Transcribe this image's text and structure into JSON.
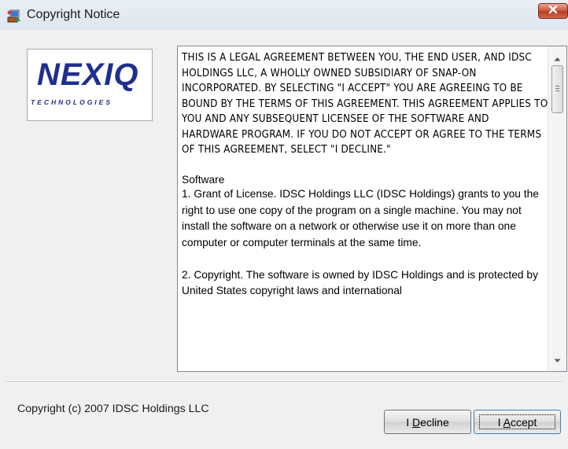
{
  "window": {
    "title": "Copyright Notice",
    "icon": "app-icon",
    "close_icon": "close-icon"
  },
  "logo": {
    "wordmark": "NEXIQ",
    "tagline": "TECHNOLOGIES"
  },
  "license": {
    "legal_paragraph": "THIS IS A LEGAL AGREEMENT BETWEEN YOU, THE END USER, AND IDSC HOLDINGS LLC, A WHOLLY OWNED SUBSIDIARY OF SNAP-ON INCORPORATED.  BY SELECTING \"I ACCEPT\" YOU ARE AGREEING TO BE BOUND BY THE TERMS OF THIS AGREEMENT.  THIS AGREEMENT APPLIES TO YOU AND ANY SUBSEQUENT LICENSEE OF THE SOFTWARE AND HARDWARE PROGRAM. IF YOU DO NOT ACCEPT OR AGREE TO THE TERMS OF THIS AGREEMENT, SELECT \"I DECLINE.\"",
    "section_heading": "Software",
    "grant_paragraph": "1. Grant of License. IDSC Holdings LLC (IDSC Holdings) grants to you the right to use one copy of the program on a single machine.  You may not install the software on a network or otherwise use it on more than one computer or computer terminals at the same time.",
    "copyright_paragraph": "2. Copyright.  The software is owned by IDSC Holdings and is protected by United States copyright laws and international"
  },
  "footer": {
    "copyright": "Copyright (c) 2007 IDSC Holdings LLC"
  },
  "buttons": {
    "decline": {
      "prefix": "I ",
      "mnemonic": "D",
      "rest": "ecline"
    },
    "accept": {
      "prefix": "I ",
      "mnemonic": "A",
      "rest": "ccept"
    }
  },
  "colors": {
    "logo": "#1f2f8f",
    "close_button": "#c8543c",
    "dialog_background": "#f0f0f0"
  }
}
